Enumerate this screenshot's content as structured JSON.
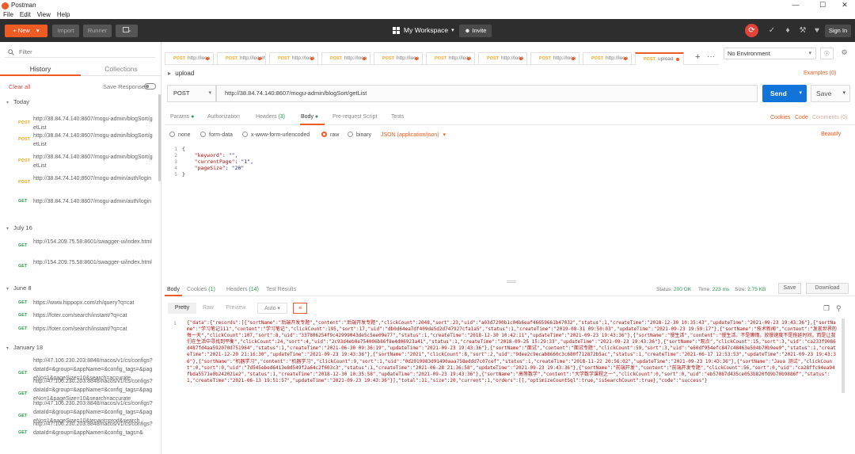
{
  "window": {
    "title": "Postman",
    "min": "—",
    "max": "☐",
    "close": "✕"
  },
  "menu": [
    "File",
    "Edit",
    "View",
    "Help"
  ],
  "header": {
    "new_label": "New",
    "new_plus": "+",
    "new_chev": "▾",
    "import_label": "Import",
    "runner_label": "Runner",
    "workspace_label": "My Workspace",
    "workspace_chev": "▾",
    "invite_label": "Invite",
    "signin_label": "Sign In"
  },
  "sidebar": {
    "filter_placeholder": "Filter",
    "tabs": [
      "History",
      "Collections"
    ],
    "clear_all": "Clear all",
    "save_responses": "Save Responses",
    "groups": [
      {
        "label": "Today",
        "items": [
          {
            "method": "POST",
            "url": "http://38.84.74.140:8607/mogu-admin/blogSort/getList"
          },
          {
            "method": "POST",
            "url": "http://38.84.74.140:8607/mogu-admin/blogSort/getList"
          },
          {
            "method": "POST",
            "url": "http://38.84.74.140:8607/mogu-admin/blogSort/getList"
          },
          {
            "method": "POST",
            "url": "http://38.84.74.140:8607/mogu-admin/auth/login"
          },
          {
            "method": "GET",
            "url": "http://38.84.74.140:8607/mogu-admin/auth/login"
          }
        ]
      },
      {
        "label": "July 16",
        "items": [
          {
            "method": "GET",
            "url": "http://154.209.75.58:8601/swagger-ui/index.html"
          },
          {
            "method": "GET",
            "url": "http://154.209.75.58:8601/swagger-ui/index.html"
          }
        ]
      },
      {
        "label": "June 8",
        "items": [
          {
            "method": "GET",
            "url": "https://www.hippopx.com/zh/query?q=cat"
          },
          {
            "method": "GET",
            "url": "https://foter.com/search/instant/?q=cat"
          },
          {
            "method": "GET",
            "url": "https://foter.com/search/instant/?q=cat"
          }
        ]
      },
      {
        "label": "January 18",
        "items": [
          {
            "method": "GET",
            "url": "http://47.106.230.203:8848/nacos/v1/cs/configs?dataId=&group=&appName=&config_tags=&pageNo=1&pageSize=10&search=accurate"
          },
          {
            "method": "GET",
            "url": "http://47.106.230.203:8848/nacos/v1/cs/configs?dataId=&group=&appName=&config_tags=&pageNo=1&pageSize=10&search=accurate"
          },
          {
            "method": "GET",
            "url": "http://47.106.230.203:8848/nacos/v1/cs/configs?dataId=&group=&appName=&config_tags=&pageNo=1&pageSize=10&tenant=prod&search"
          },
          {
            "method": "GET",
            "url": "http://47.106.230.203:8848/nacos/v1/cs/configs?dataId=&group=&appName=&config_tags=&"
          }
        ]
      }
    ]
  },
  "tabs": [
    {
      "method": "POST",
      "url": "http://loca"
    },
    {
      "method": "POST",
      "url": "http://localhos"
    },
    {
      "method": "POST",
      "url": "http://loca"
    },
    {
      "method": "POST",
      "url": "http://loca"
    },
    {
      "method": "POST",
      "url": "http://loca"
    },
    {
      "method": "POST",
      "url": "http://loca"
    },
    {
      "method": "POST",
      "url": "http://loca"
    },
    {
      "method": "POST",
      "url": "http://loca"
    },
    {
      "method": "POST",
      "url": "http://loca"
    },
    {
      "method": "POST",
      "url": "upload"
    }
  ],
  "tab_add": "+",
  "tab_more": "···",
  "environment": {
    "selected": "No Environment",
    "chev": "▾"
  },
  "request": {
    "name": "upload",
    "caret": "▸",
    "examples": "Examples (0)",
    "method": "POST",
    "url": "http://38.84.74.140:8607/mogu-admin/blogSort/getList",
    "send": "Send",
    "save": "Save",
    "tabs": {
      "params": "Params",
      "authorization": "Authorization",
      "headers": "Headers",
      "headers_count": "(3)",
      "body": "Body",
      "prerequest": "Pre-request Script",
      "tests": "Tests"
    },
    "cookies": "Cookies",
    "code": "Code",
    "comments": "Comments (0)",
    "body_types": [
      "none",
      "form-data",
      "x-www-form-urlencoded",
      "raw",
      "binary"
    ],
    "body_format": "JSON (application/json)",
    "beautify": "Beautify",
    "body_lines": [
      {
        "n": "1",
        "text": "{"
      },
      {
        "n": "2",
        "key": "\"keyword\"",
        "val": "\"\","
      },
      {
        "n": "3",
        "key": "\"currentPage\"",
        "val": "\"1\","
      },
      {
        "n": "4",
        "key": "\"pageSize\"",
        "val": "\"20\""
      },
      {
        "n": "5",
        "text": "}"
      }
    ]
  },
  "response": {
    "tabs": {
      "body": "Body",
      "cookies": "Cookies",
      "cookies_count": "(1)",
      "headers": "Headers",
      "headers_count": "(14)",
      "tests": "Test Results"
    },
    "status_label": "Status:",
    "status_value": "200 OK",
    "time_label": "Time:",
    "time_value": "223 ms",
    "size_label": "Size:",
    "size_value": "2.75 KB",
    "save": "Save",
    "download": "Download",
    "views": [
      "Pretty",
      "Raw",
      "Preview"
    ],
    "format": "Auto",
    "line_no": "1",
    "body": "{\"data\":{\"records\":[{\"sortName\":\"后端开发专题\",\"content\":\"后端开发专题\",\"clickCount\":2048,\"sort\":23,\"uid\":\"a03d7290b1c04b6eaf46659661b47032\",\"status\":1,\"createTime\":\"2018-12-30 10:35:43\",\"updateTime\":\"2021-09-23 19:43:36\"},{\"sortName\":\"学习笔记111\",\"content\":\"学习笔记\",\"clickCount\":195,\"sort\":17,\"uid\":\"db0d64ea7df409de5d2d747927cfa1a5\",\"status\":1,\"createTime\":\"2019-08-31 09:50:03\",\"updateTime\":\"2021-09-23 19:59:17\"},{\"sortName\":\"技术新闻\",\"content\":\"发现世界的每一天\",\"clickCount\":107,\"sort\":8,\"uid\":\"337806254f9c42999043de5c5ee09e77\",\"status\":1,\"createTime\":\"2018-12-30 10:42:11\",\"updateTime\":\"2021-09-23 19:43:36\"},{\"sortName\":\"慢生活\",\"content\":\"慢生活，不是懒惰，放慢速度不是拖延时间，而是让我们在生活中寻找到平衡\",\"clickCount\":24,\"sort\":4,\"uid\":\"2c93d4eb0e754006b86f8e4d06923a41\",\"status\":1,\"createTime\":\"2018-09-25 15:29:33\",\"updateTime\":\"2021-09-23 19:43:36\"},{\"sortName\":\"观点\",\"clickCount\":15,\"sort\":3,\"uid\":\"ca233f9086d487fd4aa592070d751964\",\"status\":1,\"createTime\":\"2021-06-30 09:36:19\",\"updateTime\":\"2021-09-23 19:43:36\"},{\"sortName\":\"面试\",\"content\":\"面试专题\",\"clickCount\":59,\"sort\":3,\"uid\":\"e60df954efc847c48463e504b70b9ee9\",\"status\":1,\"createTime\":\"2021-12-20 21:16:30\",\"updateTime\":\"2021-09-23 19:43:36\"},{\"sortName\":\"2021\",\"clickCount\":8,\"sort\":2,\"uid\":\"9dee2c9ecab8660c3c680f712872b5ac\",\"status\":1,\"createTime\":\"2021-06-17 12:53:53\",\"updateTime\":\"2021-09-23 19:43:36\"},{\"sortName\":\"机器学习\",\"content\":\"机器学习\",\"clickCount\":9,\"sort\":1,\"uid\":\"0d2019983d91490aaa758eddd7c07cef\",\"status\":1,\"createTime\":\"2018-11-22 20:56:02\",\"updateTime\":\"2021-09-23 19:43:36\"},{\"sortName\":\"Java 测试\",\"clickCount\":0,\"sort\":0,\"uid\":\"7d545ebed6413e8d549f2a64c2f603c3\",\"status\":1,\"createTime\":\"2021-06-28 21:36:58\",\"updateTime\":\"2021-09-23 19:43:36\"},{\"sortName\":\"前端开发\",\"content\":\"前端开发专题\",\"clickCount\":56,\"sort\":0,\"uid\":\"ca28ffc94ea94fbda5571e0b242021e2\",\"status\":1,\"createTime\":\"2018-12-30 10:35:58\",\"updateTime\":\"2021-09-23 19:43:36\"},{\"sortName\":\"高等数学\",\"content\":\"大学数学课程之一\",\"clickCount\":0,\"sort\":0,\"uid\":\"eb57087d435ce053b820fd9b70b9886f\",\"status\":1,\"createTime\":\"2021-06-13 19:51:57\",\"updateTime\":\"2021-09-23 19:43:36\"}],\"total\":11,\"size\":20,\"current\":1,\"orders\":[],\"optimizeCountSql\":true,\"isSearchCount\":true},\"code\":\"success\"}"
  },
  "colors": {
    "accent": "#ef5b25",
    "send": "#1273d8",
    "post": "#f5a623",
    "get": "#2a9d4a"
  }
}
